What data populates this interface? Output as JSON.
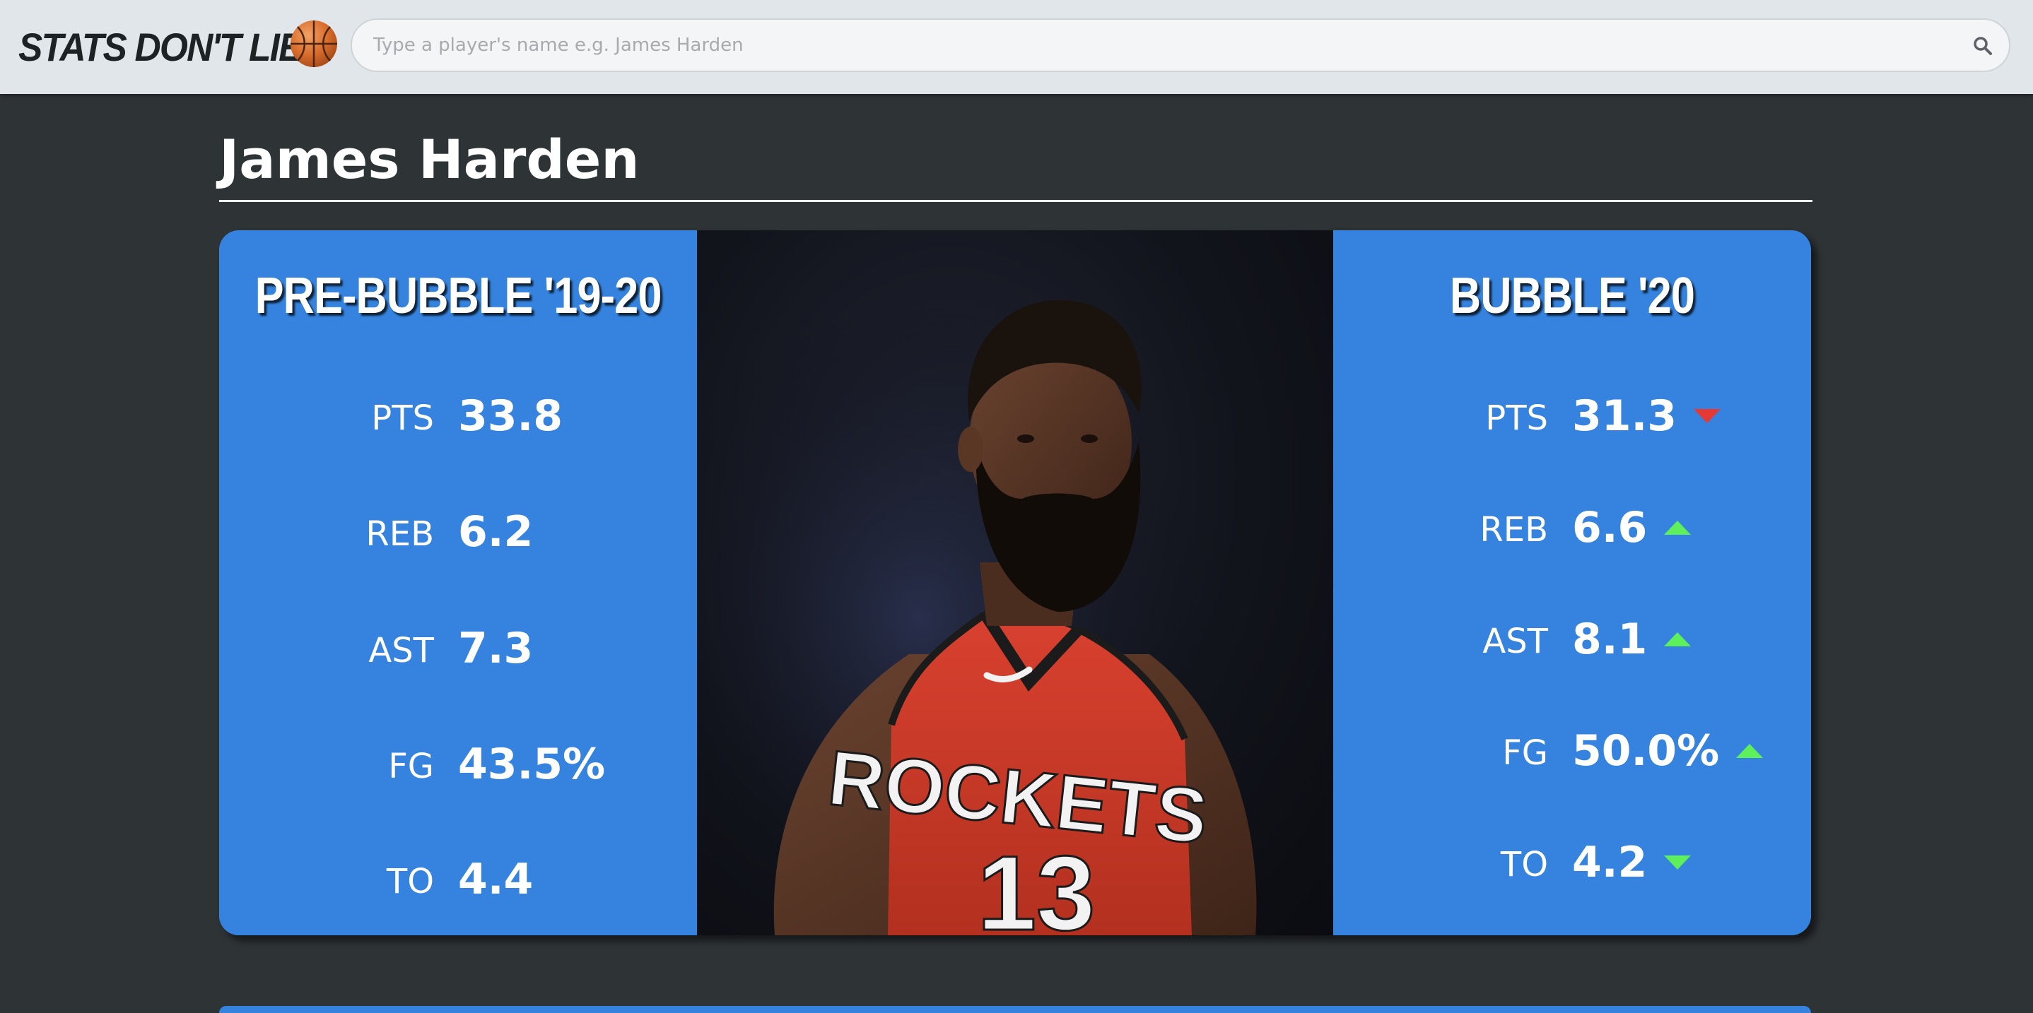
{
  "header": {
    "logo_text": "STATS DON'T LIE",
    "logo_icon": "basketball-icon",
    "search_placeholder": "Type a player's name e.g. James Harden",
    "search_icon": "search-icon"
  },
  "player": {
    "name": "James Harden",
    "photo_alt": "Player photo"
  },
  "pre_bubble": {
    "title": "PRE-BUBBLE '19-20",
    "stats": [
      {
        "label": "PTS",
        "value": "33.8"
      },
      {
        "label": "REB",
        "value": "6.2"
      },
      {
        "label": "AST",
        "value": "7.3"
      },
      {
        "label": "FG",
        "value": "43.5%"
      },
      {
        "label": "TO",
        "value": "4.4"
      }
    ]
  },
  "bubble": {
    "title": "BUBBLE '20",
    "stats": [
      {
        "label": "PTS",
        "value": "31.3",
        "trend": "down",
        "trend_color": "#e53935"
      },
      {
        "label": "REB",
        "value": "6.6",
        "trend": "up",
        "trend_color": "#5ef05a"
      },
      {
        "label": "AST",
        "value": "8.1",
        "trend": "up",
        "trend_color": "#5ef05a"
      },
      {
        "label": "FG",
        "value": "50.0%",
        "trend": "up",
        "trend_color": "#5ef05a"
      },
      {
        "label": "TO",
        "value": "4.2",
        "trend": "down",
        "trend_color": "#5ef05a"
      }
    ]
  },
  "colors": {
    "background": "#2e3336",
    "topbar": "#e1e6ea",
    "panel_blue": "#3583de",
    "trend_up": "#5ef05a",
    "trend_down_bad": "#e53935"
  }
}
